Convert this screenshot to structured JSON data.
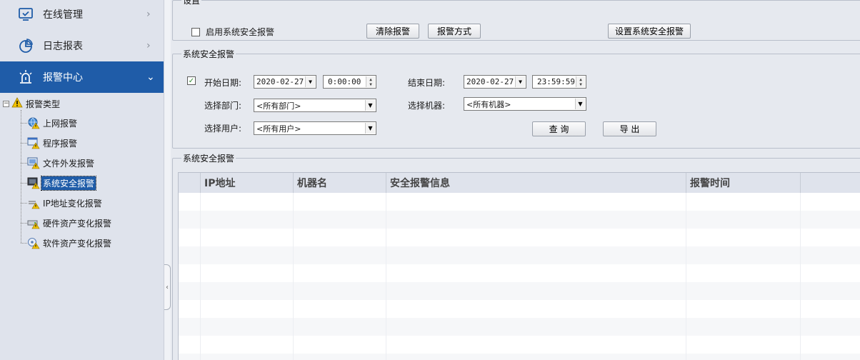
{
  "sidebar": {
    "nav": [
      {
        "id": "online",
        "label": "在线管理",
        "icon": "monitor-check-icon"
      },
      {
        "id": "log",
        "label": "日志报表",
        "icon": "pie-chart-icon"
      },
      {
        "id": "alarm",
        "label": "报警中心",
        "icon": "alarm-siren-icon",
        "active": true
      }
    ],
    "tree": {
      "root_label": "报警类型",
      "toggle": "−",
      "items": [
        {
          "label": "上网报警",
          "icon": "globe-warning-icon"
        },
        {
          "label": "程序报警",
          "icon": "program-warning-icon"
        },
        {
          "label": "文件外发报警",
          "icon": "file-send-warning-icon"
        },
        {
          "label": "系统安全报警",
          "icon": "system-security-warning-icon",
          "selected": true
        },
        {
          "label": "IP地址变化报警",
          "icon": "ip-change-warning-icon"
        },
        {
          "label": "硬件资产变化报警",
          "icon": "hardware-change-warning-icon"
        },
        {
          "label": "软件资产变化报警",
          "icon": "software-change-warning-icon"
        }
      ]
    }
  },
  "settings": {
    "legend": "设置",
    "enable_label": "启用系统安全报警",
    "enable_checked": false,
    "clear_button": "清除报警",
    "method_button": "报警方式",
    "configure_button": "设置系统安全报警"
  },
  "filter": {
    "legend": "系统安全报警",
    "start_checked": true,
    "start_label": "开始日期:",
    "start_date": "2020-02-27",
    "start_time": "0:00:00",
    "end_label": "结束日期:",
    "end_date": "2020-02-27",
    "end_time": "23:59:59",
    "dept_label": "选择部门:",
    "dept_value": "<所有部门>",
    "machine_label": "选择机器:",
    "machine_value": "<所有机器>",
    "user_label": "选择用户:",
    "user_value": "<所有用户>",
    "query_button": "查 询",
    "export_button": "导 出"
  },
  "results": {
    "legend": "系统安全报警",
    "columns": [
      "",
      "IP地址",
      "机器名",
      "安全报警信息",
      "报警时间",
      ""
    ],
    "rows": []
  },
  "colors": {
    "accent": "#1f5ca8",
    "sidebar_bg": "#dfe3ec",
    "main_bg": "#e6e9ef",
    "warning": "#f2c200"
  }
}
